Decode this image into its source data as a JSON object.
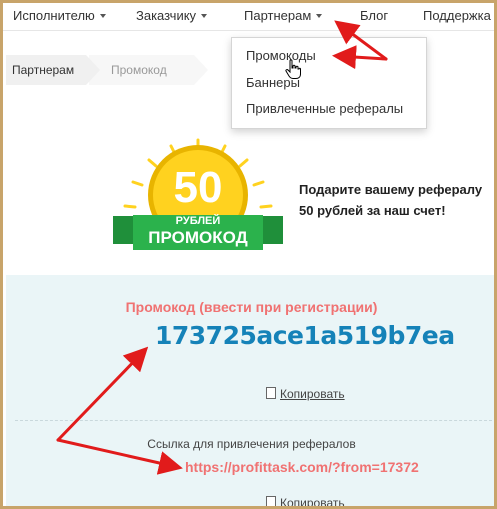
{
  "nav": {
    "items": [
      {
        "label": "Исполнителю"
      },
      {
        "label": "Заказчику"
      },
      {
        "label": "Партнерам"
      },
      {
        "label": "Блог"
      },
      {
        "label": "Поддержка"
      }
    ]
  },
  "breadcrumb": {
    "items": [
      "Партнерам",
      "Промокод"
    ]
  },
  "dropdown": {
    "items": [
      "Промокоды",
      "Баннеры",
      "Привлеченные рефералы"
    ]
  },
  "badge": {
    "amount": "50",
    "currency": "РУБЛЕЙ",
    "ribbon": "ПРОМОКОД"
  },
  "promo": {
    "line1": "Подарите вашему рефералу",
    "line2": "50 рублей за наш счет!"
  },
  "code_section": {
    "title": "Промокод (ввести при регистрации)",
    "code": "173725ace1a519b7ea",
    "copy_label": "Копировать"
  },
  "referral_section": {
    "label": "Ссылка для привлечения рефералов",
    "link": "https://profittask.com/?from=17372",
    "copy_label": "Копировать"
  },
  "colors": {
    "accent_red": "#f07272",
    "code_blue": "#1582b8",
    "panel_bg": "#eaf5f7",
    "coin_yellow": "#ffd21f",
    "ribbon_green": "#2bb24c",
    "frame": "#c8a46a",
    "arrow_red": "#e11b1b"
  }
}
